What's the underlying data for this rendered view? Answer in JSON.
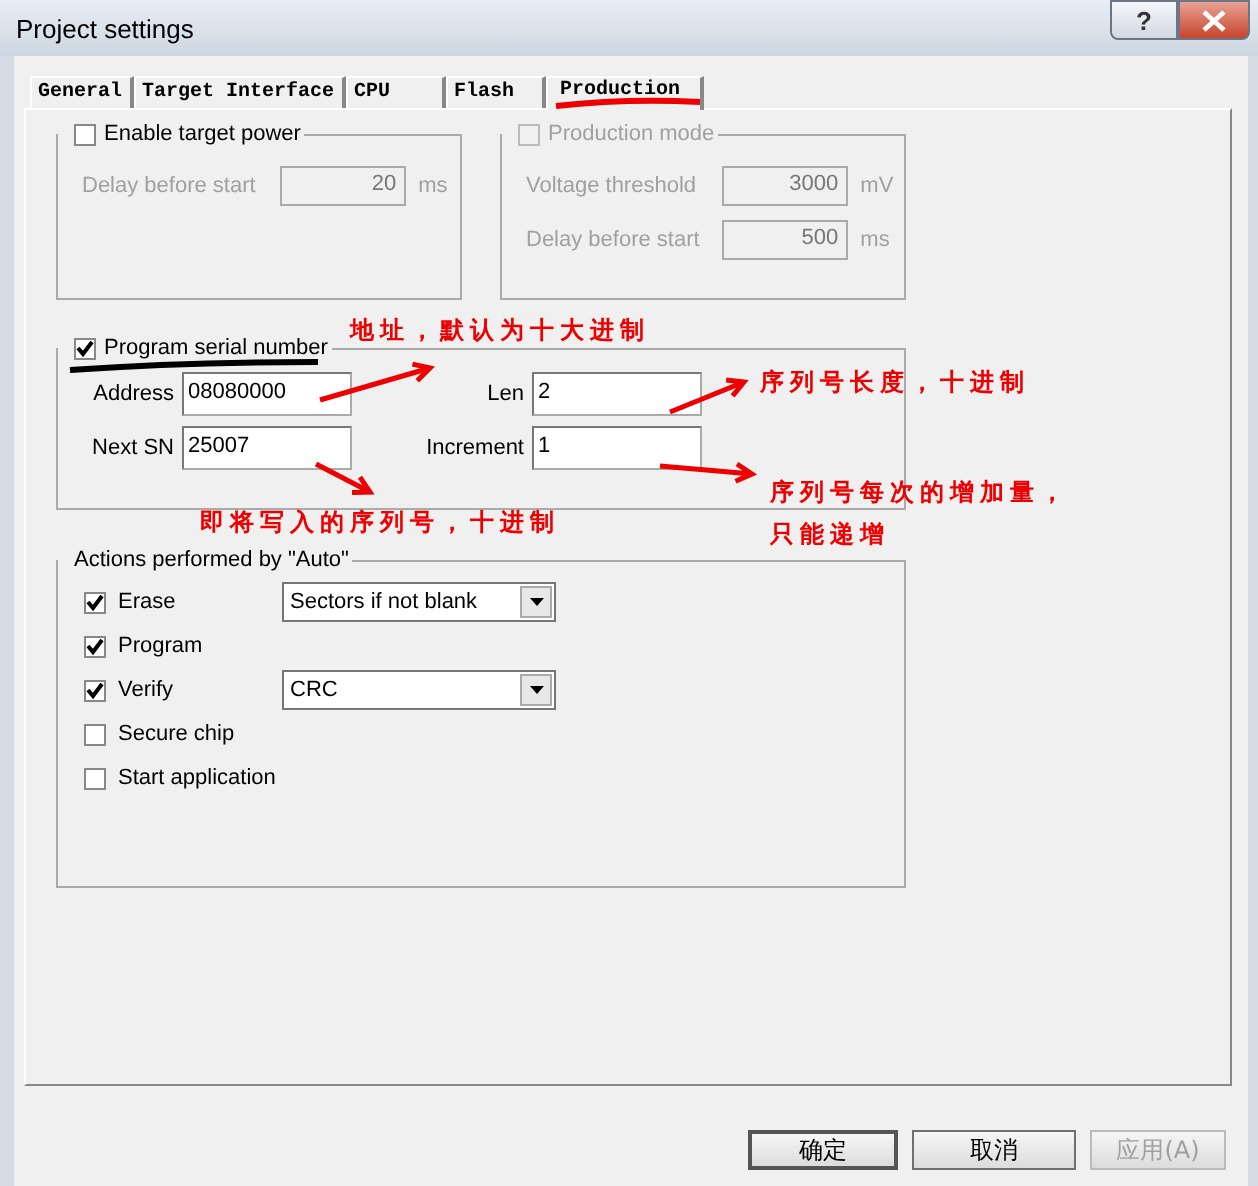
{
  "window": {
    "title": "Project settings",
    "help": "?"
  },
  "tabs": [
    {
      "label": "General",
      "selected": false
    },
    {
      "label": "Target Interface",
      "selected": false
    },
    {
      "label": "CPU",
      "selected": false
    },
    {
      "label": "Flash",
      "selected": false
    },
    {
      "label": "Production",
      "selected": true
    }
  ],
  "target_power": {
    "label": "Enable target power",
    "checked": false,
    "disabled": false,
    "fields": [
      {
        "label": "Delay before start",
        "value": "20",
        "unit": "ms",
        "disabled": true
      }
    ]
  },
  "production_mode": {
    "label": "Production mode",
    "checked": false,
    "disabled": true,
    "fields": [
      {
        "label": "Voltage threshold",
        "value": "3000",
        "unit": "mV",
        "disabled": true
      },
      {
        "label": "Delay before start",
        "value": "500",
        "unit": "ms",
        "disabled": true
      }
    ]
  },
  "serial": {
    "label": "Program serial number",
    "checked": true,
    "fields": [
      {
        "label": "Address",
        "value": "08080000"
      },
      {
        "label": "Len",
        "value": "2"
      },
      {
        "label": "Next SN",
        "value": "25007"
      },
      {
        "label": "Increment",
        "value": "1"
      }
    ]
  },
  "actions": {
    "title": "Actions performed by \"Auto\"",
    "items": [
      {
        "label": "Erase",
        "checked": true,
        "dropdown": "Sectors if not blank"
      },
      {
        "label": "Program",
        "checked": true
      },
      {
        "label": "Verify",
        "checked": true,
        "dropdown": "CRC"
      },
      {
        "label": "Secure chip",
        "checked": false
      },
      {
        "label": "Start application",
        "checked": false
      }
    ]
  },
  "buttons": [
    {
      "label": "确定",
      "disabled": false
    },
    {
      "label": "取消",
      "disabled": false
    },
    {
      "label": "应用(A)",
      "disabled": true
    }
  ],
  "annotations": [
    {
      "text": "地址，默认为十大进制"
    },
    {
      "text": "序列号长度，十进制"
    },
    {
      "text": "即将写入的序列号，十进制"
    },
    {
      "text": "序列号每次的增加量，只能递增"
    }
  ]
}
